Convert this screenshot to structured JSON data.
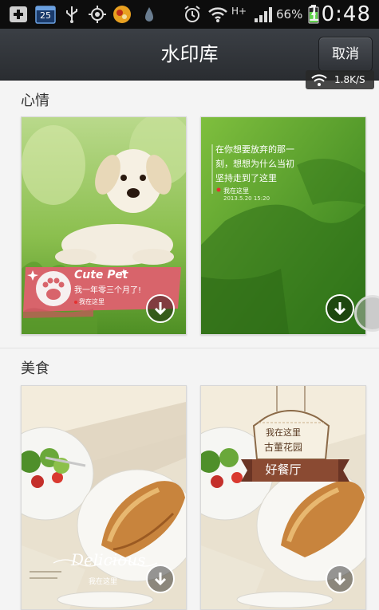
{
  "status_bar": {
    "date_badge": "25",
    "network_type": "H+",
    "battery": "66%",
    "time": "10:48"
  },
  "header": {
    "title": "水印库",
    "cancel_label": "取消"
  },
  "speed_overlay": {
    "text": "1.8K/S"
  },
  "sections": [
    {
      "title": "心情",
      "cards": [
        {
          "name": "Cute Pet",
          "line1": "我一年零三个月了!",
          "line2": "我在这里"
        },
        {
          "poem": [
            "在你想要放弃的那一",
            "刻，想想为什么当初",
            "坚持走到了这里"
          ],
          "location": "我在这里",
          "date": "2013.5.20 15:20"
        }
      ]
    },
    {
      "title": "美食",
      "cards": [
        {
          "script": "Delicious",
          "location": "我在这里"
        },
        {
          "top": "我在这里",
          "place": "古董花园",
          "banner": "好餐厅"
        }
      ]
    }
  ]
}
